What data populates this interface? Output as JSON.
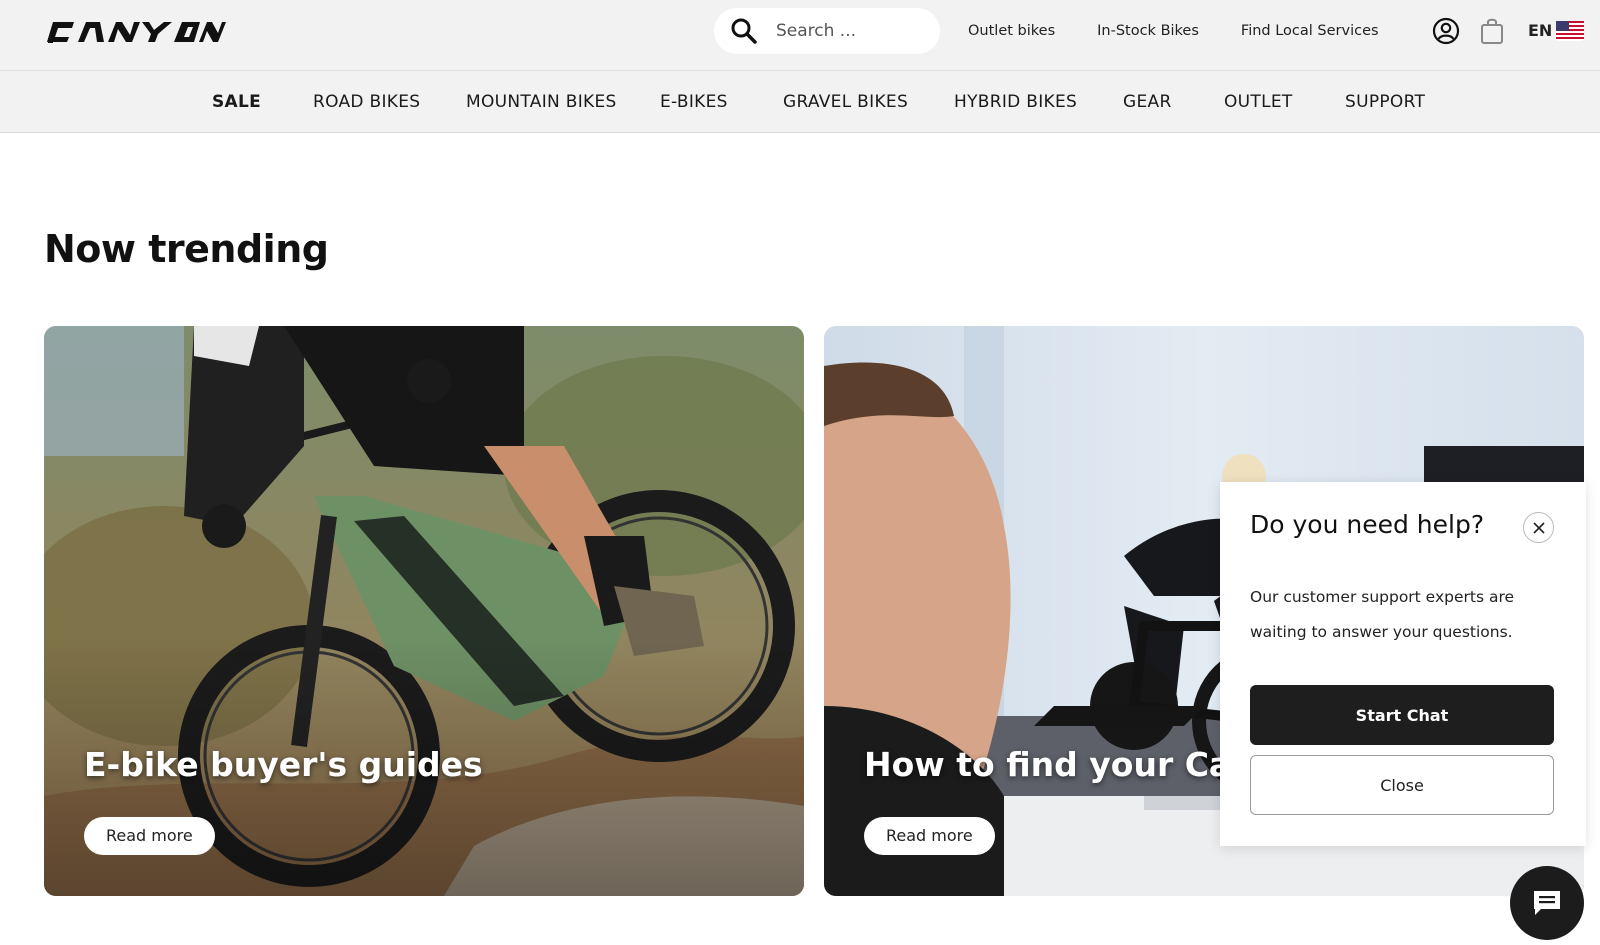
{
  "header": {
    "logo_text": "CANYON",
    "search_placeholder": "Search ...",
    "utility_links": [
      "Outlet bikes",
      "In-Stock Bikes",
      "Find Local Services"
    ],
    "language": "EN",
    "icons": [
      "search-icon",
      "account-icon",
      "shopping-bag-icon",
      "us-flag-icon"
    ]
  },
  "nav": {
    "items": [
      {
        "label": "SALE",
        "active": true
      },
      {
        "label": "ROAD BIKES",
        "active": false
      },
      {
        "label": "MOUNTAIN BIKES",
        "active": false
      },
      {
        "label": "E-BIKES",
        "active": false
      },
      {
        "label": "GRAVEL BIKES",
        "active": false
      },
      {
        "label": "HYBRID BIKES",
        "active": false
      },
      {
        "label": "GEAR",
        "active": false
      },
      {
        "label": "OUTLET",
        "active": false
      },
      {
        "label": "SUPPORT",
        "active": false
      }
    ]
  },
  "trending": {
    "title": "Now trending",
    "cards": [
      {
        "title": "E-bike buyer's guides",
        "button": "Read more"
      },
      {
        "title": "How to find your Canyon",
        "button": "Read more"
      }
    ]
  },
  "help_popup": {
    "title": "Do you need help?",
    "body": "Our customer support experts are waiting to answer your questions.",
    "start_chat": "Start Chat",
    "close": "Close"
  },
  "colors": {
    "bar_background": "#f2f2f2",
    "primary_button": "#1e1e1e",
    "text": "#1a1a1a"
  }
}
